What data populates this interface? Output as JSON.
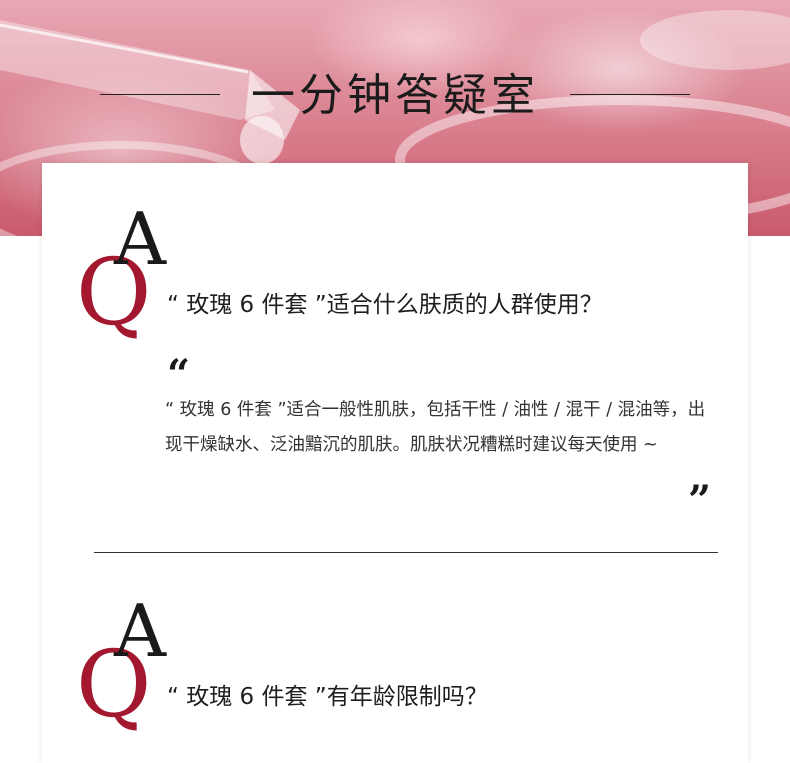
{
  "header": {
    "title": "一分钟答疑室"
  },
  "qa_items": [
    {
      "q_letter": "Q",
      "a_letter": "A",
      "question": "“ 玫瑰 6 件套 ”适合什么肤质的人群使用？",
      "quote_open": "“",
      "quote_close": "”",
      "answer": "“ 玫瑰 6 件套 ”适合一般性肌肤，包括干性 / 油性 / 混干 / 混油等，出现干燥缺水、泛油黯沉的肌肤。肌肤状况糟糕时建议每天使用 ~"
    },
    {
      "q_letter": "Q",
      "a_letter": "A",
      "question": "“ 玫瑰 6 件套 ”有年龄限制吗？"
    }
  ],
  "colors": {
    "q_accent": "#a3182e",
    "banner_pink": "#d97e8d"
  }
}
